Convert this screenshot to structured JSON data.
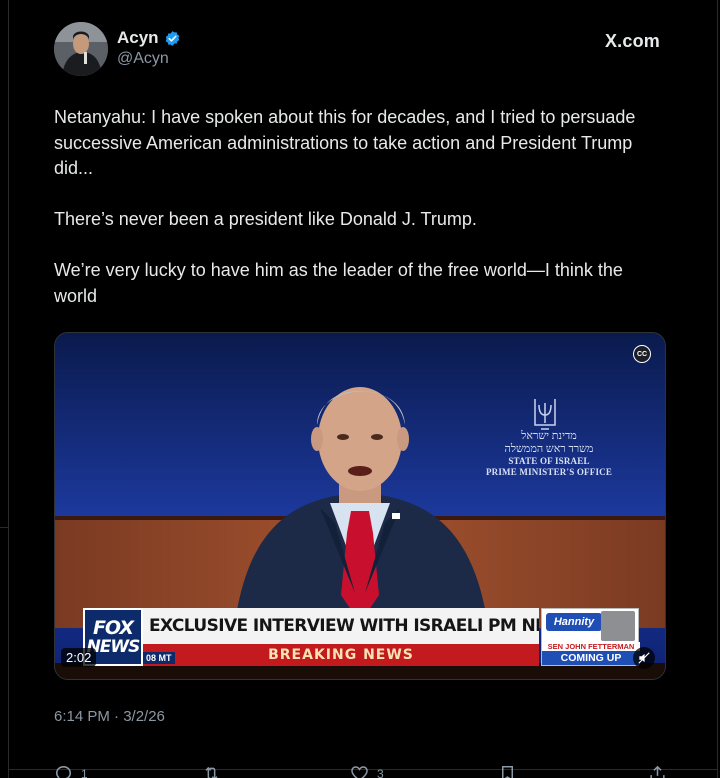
{
  "author": {
    "display_name": "Acyn",
    "handle": "@Acyn",
    "verified": true
  },
  "brand": {
    "logo_text": "X.com"
  },
  "tweet": {
    "paragraphs": [
      "Netanyahu: I have spoken about this for decades, and I tried to persuade successive American administrations to take action and President Trump did...",
      "There’s never been a president like Donald J. Trump.",
      "We’re very lucky to have him as the leader of the free world—I think the world"
    ],
    "timestamp": "6:14 PM · 3/2/26"
  },
  "video": {
    "duration": "2:02",
    "cc_label": "CC",
    "seal": {
      "hebrew_line1": "מדינת ישראל",
      "hebrew_line2": "משרד ראש הממשלה",
      "english_line1": "STATE OF ISRAEL",
      "english_line2": "PRIME MINISTER'S OFFICE"
    },
    "chyron": {
      "logo_top": "FOX",
      "logo_bottom": "NEWS",
      "headline": "EXCLUSIVE INTERVIEW WITH ISRAELI PM NETANYAHU",
      "ticker": "BREAKING NEWS",
      "time_tag": "08 MT",
      "promo_show": "Hannity",
      "promo_guest": "SEN JOHN FETTERMAN",
      "promo_status": "COMING UP"
    }
  },
  "actions": {
    "reply_count": "1",
    "retweet_count": "",
    "like_count": "3"
  },
  "colors": {
    "background": "#000000",
    "text_primary": "#e7e9ea",
    "text_secondary": "#8b98a5",
    "verified": "#1d9bf0",
    "fox_red": "#c21a1f",
    "fox_blue": "#0d2a6b"
  }
}
